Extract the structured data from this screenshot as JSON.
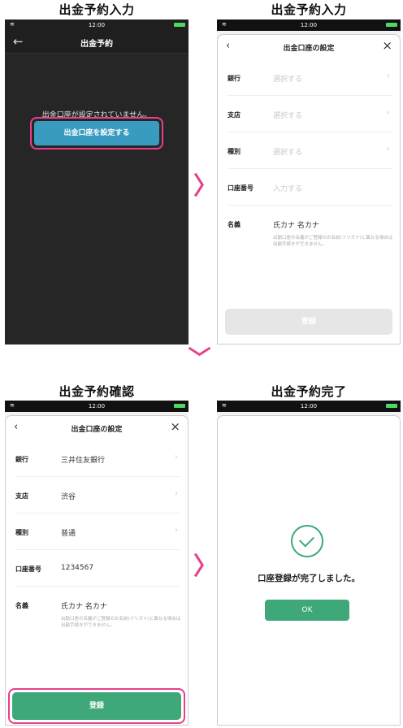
{
  "headings": [
    "出金予約入力",
    "出金予約入力",
    "出金予約確認",
    "出金予約完了"
  ],
  "status_time": "12:00",
  "screen1": {
    "nav_title": "出金予約",
    "message": "出金口座が設定されていません。",
    "button": "出金口座を設定する"
  },
  "form": {
    "title": "出金口座の設定",
    "labels": {
      "bank": "銀行",
      "branch": "支店",
      "type": "種別",
      "account": "口座番号",
      "name": "名義"
    },
    "placeholders": {
      "select": "選択する",
      "input": "入力する"
    },
    "name_value": "氏カナ 名カナ",
    "note": "出勤口座の名義がご登録のお名前(フリガナ)と異なる場合は出勤手続きができません。",
    "register": "登録"
  },
  "confirm": {
    "bank": "三井住友銀行",
    "branch": "渋谷",
    "type": "普通",
    "account": "1234567"
  },
  "done": {
    "message": "口座登録が完了しました。",
    "ok": "OK"
  },
  "colors": {
    "accent_pink": "#e83e8c",
    "green": "#3ea879",
    "blue": "#3a9bc0"
  }
}
